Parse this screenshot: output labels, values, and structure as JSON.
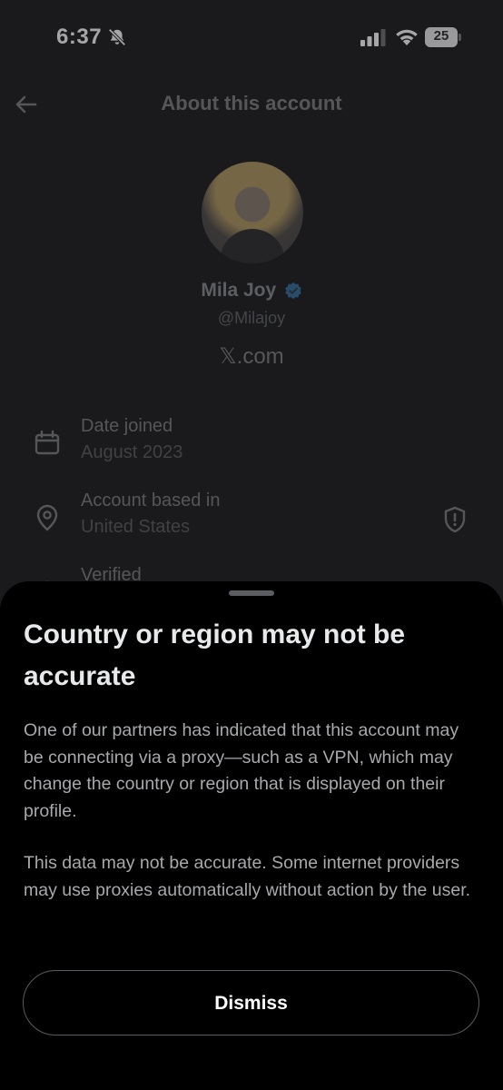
{
  "status_bar": {
    "time": "6:37",
    "battery": "25"
  },
  "header": {
    "title": "About this account"
  },
  "profile": {
    "name": "Mila Joy",
    "handle": "@Milajoy",
    "source": "𝕏.com",
    "verified_color": "#1d9bf0"
  },
  "info": [
    {
      "label": "Date joined",
      "value": "August 2023",
      "icon": "calendar-icon"
    },
    {
      "label": "Account based in",
      "value": "United States",
      "icon": "location-pin-icon"
    },
    {
      "label": "Verified",
      "value": "",
      "icon": "verified-badge-icon"
    }
  ],
  "sheet": {
    "title": "Country or region may not be accurate",
    "paragraph1": "One of our partners has indicated that this account may be connecting via a proxy—such as a VPN, which may change the country or region that is displayed on their profile.",
    "paragraph2": "This data may not be accurate. Some internet providers may use proxies automatically without action by the user.",
    "dismiss_label": "Dismiss"
  }
}
